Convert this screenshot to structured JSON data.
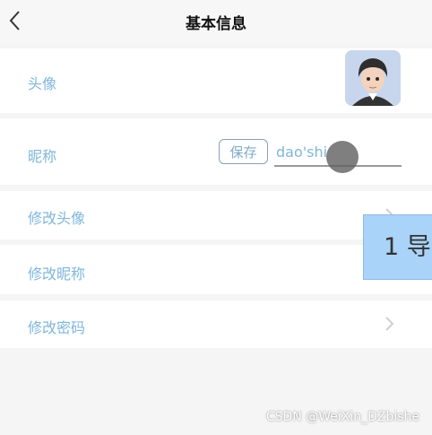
{
  "header": {
    "title": "基本信息",
    "back_icon": "chevron-left-icon"
  },
  "rows": {
    "avatar": {
      "label": "头像"
    },
    "nickname": {
      "label": "昵称",
      "save_label": "保存",
      "input_value": "dao'shi"
    },
    "change_avatar": {
      "label": "修改头像"
    },
    "change_nickname": {
      "label": "修改昵称"
    },
    "change_password": {
      "label": "修改密码"
    }
  },
  "toast": {
    "text": "1 导"
  },
  "watermark": "CSDN @WeiXin_DZbishe",
  "colors": {
    "label": "#7fb6da",
    "toast_bg": "#a9d3f8",
    "background": "#f5f5f5"
  }
}
